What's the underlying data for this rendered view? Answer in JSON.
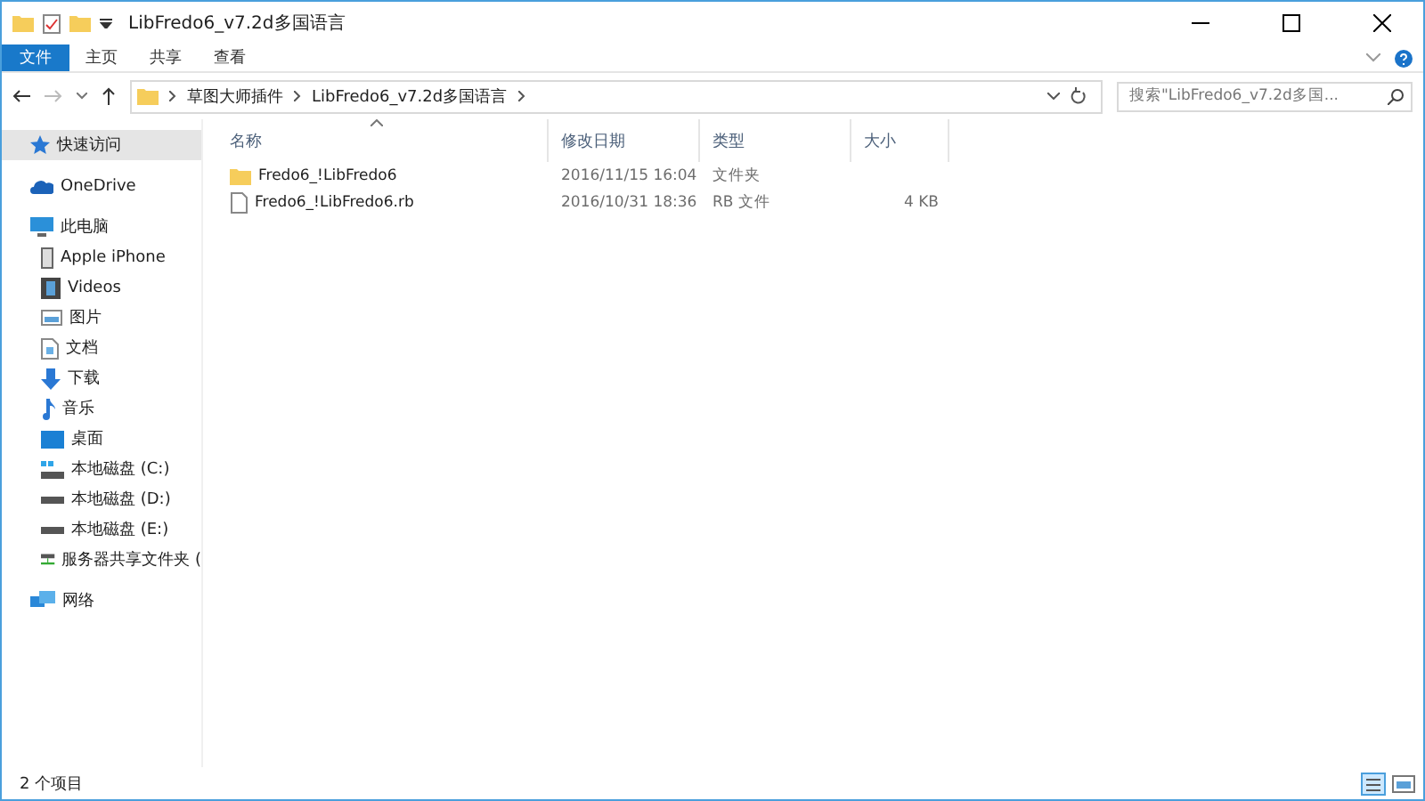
{
  "window": {
    "title": "LibFredo6_v7.2d多国语言"
  },
  "ribbon_tabs": [
    {
      "label": "文件",
      "selected": true
    },
    {
      "label": "主页",
      "selected": false
    },
    {
      "label": "共享",
      "selected": false
    },
    {
      "label": "查看",
      "selected": false
    }
  ],
  "address_bar": {
    "path": [
      "草图大师插件",
      "LibFredo6_v7.2d多国语言"
    ]
  },
  "search": {
    "placeholder": "搜索\"LibFredo6_v7.2d多国..."
  },
  "sidebar": {
    "items": [
      {
        "label": "快速访问",
        "kind": "star",
        "selected": true
      },
      {
        "label": "OneDrive",
        "kind": "cloud",
        "selected": false
      },
      {
        "label": "此电脑",
        "kind": "computer",
        "selected": false,
        "children": [
          {
            "label": "Apple iPhone",
            "kind": "phone",
            "selected": false
          },
          {
            "label": "Videos",
            "kind": "video",
            "selected": false
          },
          {
            "label": "图片",
            "kind": "picture",
            "selected": false
          },
          {
            "label": "文档",
            "kind": "document",
            "selected": false
          },
          {
            "label": "下载",
            "kind": "download",
            "selected": false
          },
          {
            "label": "音乐",
            "kind": "music",
            "selected": false
          },
          {
            "label": "桌面",
            "kind": "desktop",
            "selected": false
          },
          {
            "label": "本地磁盘 (C:)",
            "kind": "system-drive",
            "selected": false
          },
          {
            "label": "本地磁盘 (D:)",
            "kind": "drive",
            "selected": false
          },
          {
            "label": "本地磁盘 (E:)",
            "kind": "drive",
            "selected": false
          },
          {
            "label": "服务器共享文件夹 (",
            "kind": "network-drive",
            "selected": false
          }
        ]
      },
      {
        "label": "网络",
        "kind": "network",
        "selected": false
      }
    ]
  },
  "table": {
    "columns": [
      "名称",
      "修改日期",
      "类型",
      "大小"
    ],
    "rows": [
      {
        "kind": "folder",
        "name": "Fredo6_!LibFredo6",
        "modified": "2016/11/15 16:04",
        "type": "文件夹",
        "size": ""
      },
      {
        "kind": "file",
        "name": "Fredo6_!LibFredo6.rb",
        "modified": "2016/10/31 18:36",
        "type": "RB 文件",
        "size": "4 KB"
      }
    ]
  },
  "status_bar": {
    "text": "2 个项目"
  }
}
